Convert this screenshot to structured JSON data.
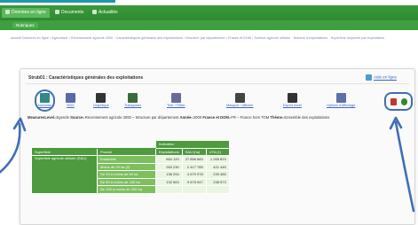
{
  "tabs": [
    {
      "label": "Données en ligne",
      "active": true
    },
    {
      "label": "Documents",
      "active": false
    },
    {
      "label": "Actualités",
      "active": false
    }
  ],
  "subtab": {
    "label": "Rubriques"
  },
  "breadcrumb": "Accueil Données en ligne › Agriculture › Recensement agricole 2000 › Caractéristiques générales des exploitations › Structure par département › France et DOM › Surface agricole utilisée · Nombre d'exploitations · Superficie moyenne par exploitation",
  "panel": {
    "title": "Strub01 : Caractéristiques générales des exploitations",
    "help_label": "Aide en ligne"
  },
  "toolbar": [
    {
      "name": "tool-nouveau",
      "label": "Nouveau",
      "color": "#2f8a8a"
    },
    {
      "name": "tool-mdx",
      "label": "MDX",
      "color": "#5a6aa8"
    },
    {
      "name": "tool-graphique",
      "label": "Graphique",
      "color": "#333333"
    },
    {
      "name": "tool-transposer",
      "label": "Transposer",
      "color": "#3a6a3a"
    },
    {
      "name": "tool-trier",
      "label": "Trier / Filtrer",
      "color": "#6a6a9a"
    },
    {
      "name": "tool-masquer",
      "label": "Masquer / Afficher",
      "color": "#444444"
    },
    {
      "name": "tool-exporter",
      "label": "Export excel",
      "color": "#333333"
    },
    {
      "name": "tool-options",
      "label": "Options d'affichage",
      "color": "#5a70a8"
    }
  ],
  "right_tools": [
    {
      "name": "print-icon",
      "color": "#c0392b"
    },
    {
      "name": "refresh-icon",
      "color": "#2e8a30"
    }
  ],
  "measure": {
    "k1": "MeasuresLevel",
    "v1": "=Egende",
    "k2": "Source",
    "v2": "=Recensement agricole 2000 – Structure par département",
    "k3": "Année",
    "v3": "=2000",
    "k4": "France et DOM",
    "v4": "=FR – France hors TOM",
    "k5": "Thème",
    "v5": "=Ensemble des exploitations"
  },
  "table": {
    "header_top": "Indicateur",
    "headers": [
      "Superficie",
      "Produit",
      "Exploitations",
      "SAU (ha)",
      "UTA (1)"
    ],
    "dimension": "Superficie agricole utilisée (SAU)",
    "rows": [
      {
        "label": "Ensemble",
        "values": [
          "664 120",
          "27 856 683",
          "1 265 823"
        ]
      },
      {
        "label": "Moins de 20 ha (2)",
        "values": [
          "263 230",
          "2 417 785",
          "421 445"
        ]
      },
      {
        "label": "De 20 à moins de 50 ha",
        "values": [
          "138 294",
          "4 670 978",
          "230 465"
        ]
      },
      {
        "label": "De 50 à moins de 100 ha",
        "values": [
          "132 563",
          "9 675 547",
          "238 573"
        ]
      }
    ],
    "partial_row": "De 100 à moins de 200 ha"
  },
  "colors": {
    "tabbar_green": "#2e8a30",
    "table_green": "#4e9a3e",
    "row_green": "#7cc05e",
    "cell_fill": "#eaf6e1",
    "annotation_blue": "#3f6fb3",
    "link_blue": "#3a66c4"
  }
}
